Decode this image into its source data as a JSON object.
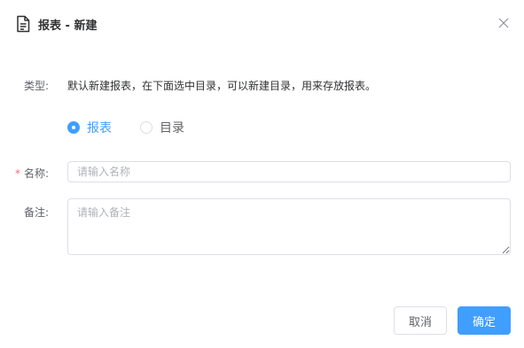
{
  "dialog": {
    "title": "报表 - 新建",
    "icon": "document-icon",
    "close_icon": "close-icon"
  },
  "form": {
    "type_label": "类型:",
    "type_hint": "默认新建报表，在下面选中目录，可以新建目录，用来存放报表。",
    "type_options": [
      {
        "label": "报表",
        "checked": true
      },
      {
        "label": "目录",
        "checked": false
      }
    ],
    "name_required_mark": "*",
    "name_label": "名称:",
    "name_placeholder": "请输入名称",
    "name_value": "",
    "remark_label": "备注:",
    "remark_placeholder": "请输入备注",
    "remark_value": ""
  },
  "footer": {
    "cancel_label": "取消",
    "ok_label": "确定"
  },
  "colors": {
    "primary": "#409eff",
    "required": "#f56c6c",
    "border": "#dcdfe6"
  }
}
